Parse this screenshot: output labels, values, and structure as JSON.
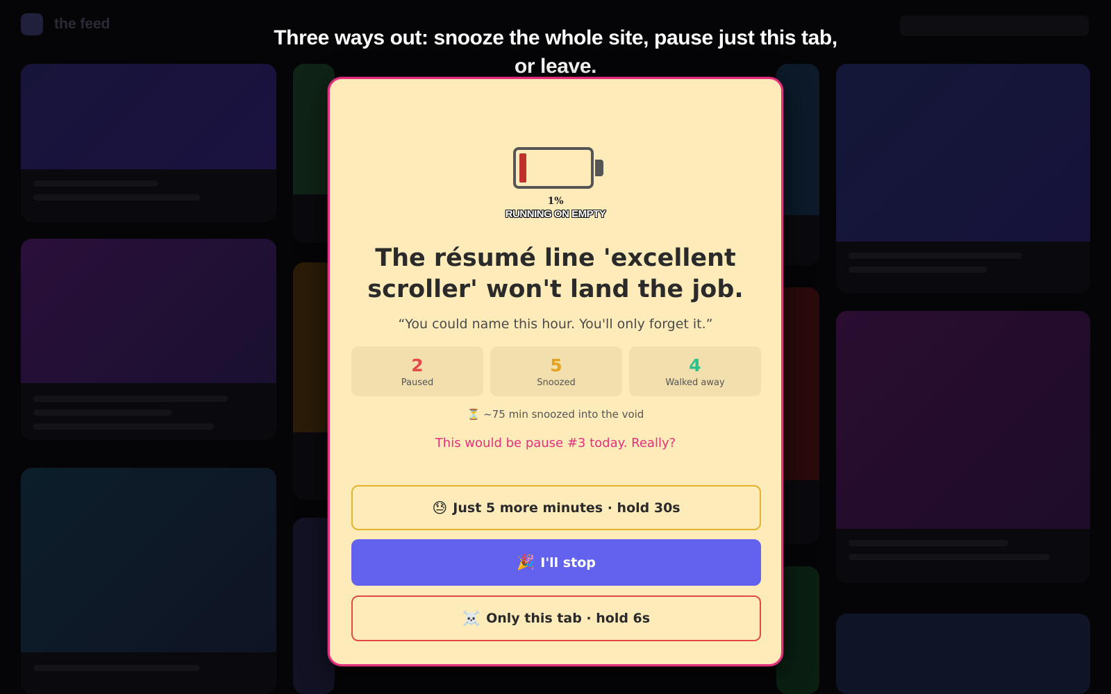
{
  "background": {
    "app_title": "the feed"
  },
  "caption": "Three ways out: snooze the whole site, pause just this tab, or leave.",
  "modal": {
    "battery": {
      "level_percent": 1,
      "percent_text": "1%",
      "label": "RUNNING ON EMPTY",
      "level_color": "#c0312b"
    },
    "headline": "The résumé line 'excellent scroller' won't land the job.",
    "quote": "“You could name this hour. You'll only forget it.”",
    "stats": [
      {
        "value": "2",
        "label": "Paused",
        "color": "#e34b4b"
      },
      {
        "value": "5",
        "label": "Snoozed",
        "color": "#e5a11f"
      },
      {
        "value": "4",
        "label": "Walked away",
        "color": "#2cc28d"
      }
    ],
    "void_line": {
      "icon": "hourglass-icon",
      "glyph": "⏳",
      "text": "~75 min snoozed into the void"
    },
    "warning": "This would be pause #3 today. Really?",
    "buttons": {
      "snooze": {
        "glyph": "😓",
        "icon": "sweat-face-icon",
        "label": "Just 5 more minutes · hold 30s"
      },
      "stop": {
        "glyph": "🎉",
        "icon": "party-popper-icon",
        "label": "I'll stop"
      },
      "tab": {
        "glyph": "☠️",
        "icon": "skull-crossbones-icon",
        "label": "Only this tab · hold 6s"
      }
    },
    "accent_color": "#e5307e",
    "background_color": "#fdebb9"
  }
}
